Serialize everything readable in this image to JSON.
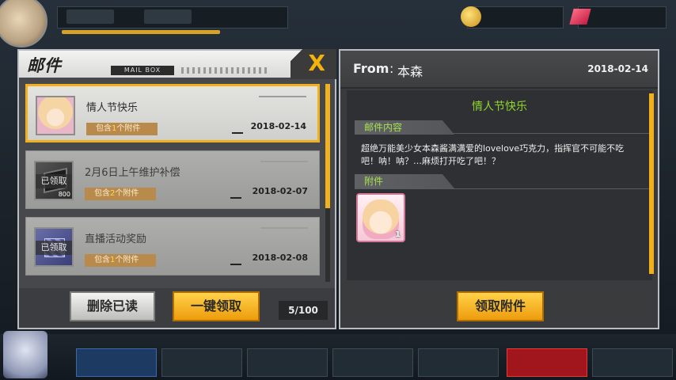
{
  "mail_panel": {
    "title": "邮件",
    "subtitle": "MAIL BOX",
    "close_label": "X",
    "mails": [
      {
        "subject": "情人节快乐",
        "attachment_prefix": "包含",
        "attachment_count": "1",
        "attachment_suffix": "个附件",
        "date": "2018-02-14",
        "claimed_label": "",
        "thumb": "valentine-girl-thumb"
      },
      {
        "subject": "2月6日上午维护补偿",
        "attachment_prefix": "包含",
        "attachment_count": "2",
        "attachment_suffix": "个附件",
        "date": "2018-02-07",
        "claimed_label": "已领取",
        "thumb_qty": "800",
        "thumb": "supply-box-thumb"
      },
      {
        "subject": "直播活动奖励",
        "attachment_prefix": "包含",
        "attachment_count": "1",
        "attachment_suffix": "个附件",
        "date": "2018-02-08",
        "claimed_label": "已领取",
        "thumb": "gift-package-thumb"
      }
    ],
    "delete_read_label": "删除已读",
    "claim_all_label": "一键领取",
    "count": "5/100"
  },
  "detail_panel": {
    "from_label": "From",
    "from_separator": ":",
    "sender": "本森",
    "date": "2018-02-14",
    "subject": "情人节快乐",
    "content_section_label": "邮件内容",
    "content_text": "超绝万能美少女本森酱满满爱的lovelove巧克力，指挥官不可能不吃吧！呐！呐？…麻烦打开吃了吧！？",
    "attachment_section_label": "附件",
    "reward_qty": "1",
    "claim_attachment_label": "领取附件"
  },
  "colors": {
    "accent": "#f1b01c",
    "subject_green": "#8fd82c",
    "badge_brown": "#b88a4c"
  }
}
